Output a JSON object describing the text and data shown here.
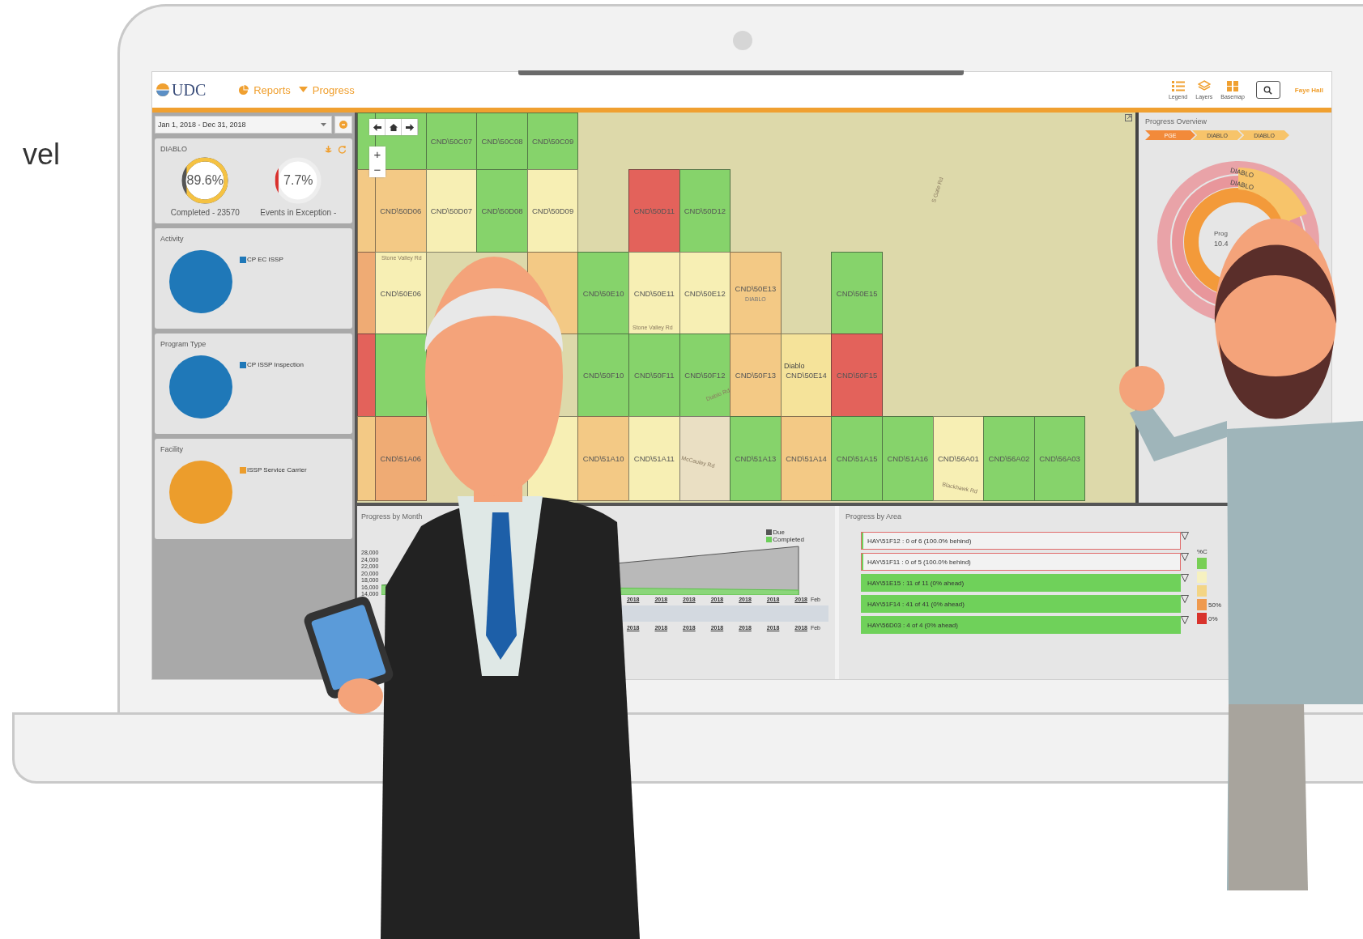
{
  "side_text": "vel",
  "header": {
    "logo": "UDC",
    "breadcrumb": [
      {
        "label": "Reports",
        "kind": "pie"
      },
      {
        "label": "Progress",
        "kind": "caret"
      }
    ],
    "tools": [
      {
        "label": "Legend",
        "kind": "list"
      },
      {
        "label": "Layers",
        "kind": "layers"
      },
      {
        "label": "Basemap",
        "kind": "grid"
      }
    ],
    "user": "Faye Hall"
  },
  "filters": {
    "date_range": "Jan 1, 2018 - Dec 31, 2018"
  },
  "summary": {
    "title": "DIABLO",
    "gauges": [
      {
        "value": "89.6%",
        "level": 0.896,
        "caption": "Completed - 23570",
        "color": "#f5c242"
      },
      {
        "value": "7.7%",
        "level": 0.077,
        "caption": "Events in Exception -",
        "color": "#d9302c"
      }
    ]
  },
  "pie_cards": [
    {
      "title": "Activity",
      "legend": "CP EC ISSP",
      "color": "#1f78b8"
    },
    {
      "title": "Program Type",
      "legend": "CP ISSP Inspection",
      "color": "#1f78b8"
    },
    {
      "title": "Facility",
      "legend": "ISSP Service Carrier",
      "color": "#ec9d2c"
    }
  ],
  "map": {
    "zoom": [
      "+",
      "−"
    ],
    "rows": [
      [
        {
          "kind": "cell",
          "color": "#86d36b"
        },
        {
          "kind": "cell",
          "color": "#86d36b"
        },
        {
          "kind": "cell",
          "color": "#86d36b",
          "label": "CND\\50C07"
        },
        {
          "kind": "cell",
          "color": "#86d36b",
          "label": "CND\\50C08"
        },
        {
          "kind": "cell",
          "color": "#86d36b",
          "label": "CND\\50C09"
        },
        {
          "kind": "blank"
        },
        {
          "kind": "blank"
        },
        {
          "kind": "blank"
        },
        {
          "kind": "blank"
        },
        {
          "kind": "blank"
        },
        {
          "kind": "blank"
        },
        {
          "kind": "blank"
        },
        {
          "kind": "blank"
        },
        {
          "kind": "blank"
        },
        {
          "kind": "blank"
        }
      ],
      [
        {
          "kind": "cell",
          "color": "#f3c985"
        },
        {
          "kind": "cell",
          "color": "#f3c985",
          "label": "CND\\50D06"
        },
        {
          "kind": "cell",
          "color": "#f7efb4",
          "label": "CND\\50D07"
        },
        {
          "kind": "cell",
          "color": "#86d36b",
          "label": "CND\\50D08"
        },
        {
          "kind": "cell",
          "color": "#f7efb4",
          "label": "CND\\50D09"
        },
        {
          "kind": "blank"
        },
        {
          "kind": "cell",
          "color": "#e3625b",
          "label": "CND\\50D11"
        },
        {
          "kind": "cell",
          "color": "#86d36b",
          "label": "CND\\50D12"
        },
        {
          "kind": "blank"
        },
        {
          "kind": "blank"
        },
        {
          "kind": "blank"
        },
        {
          "kind": "blank"
        },
        {
          "kind": "blank"
        },
        {
          "kind": "blank"
        },
        {
          "kind": "blank"
        }
      ],
      [
        {
          "kind": "cell",
          "color": "#efab74"
        },
        {
          "kind": "cell",
          "color": "#f7efb4",
          "label": "CND\\50E06"
        },
        {
          "kind": "blank"
        },
        {
          "kind": "blank"
        },
        {
          "kind": "cell",
          "color": "#f3c985"
        },
        {
          "kind": "cell",
          "color": "#86d36b",
          "label": "CND\\50E10"
        },
        {
          "kind": "cell",
          "color": "#f7efb4",
          "label": "CND\\50E11"
        },
        {
          "kind": "cell",
          "color": "#f7efb4",
          "label": "CND\\50E12"
        },
        {
          "kind": "cell",
          "color": "#f3c985",
          "label": "CND\\50E13",
          "sub": "DIABLO"
        },
        {
          "kind": "blank"
        },
        {
          "kind": "cell",
          "color": "#86d36b",
          "label": "CND\\50E15"
        },
        {
          "kind": "blank"
        },
        {
          "kind": "blank"
        },
        {
          "kind": "blank"
        },
        {
          "kind": "blank"
        }
      ],
      [
        {
          "kind": "cell",
          "color": "#e3625b"
        },
        {
          "kind": "cell",
          "color": "#86d36b"
        },
        {
          "kind": "blank"
        },
        {
          "kind": "blank"
        },
        {
          "kind": "blank"
        },
        {
          "kind": "cell",
          "color": "#86d36b",
          "label": "CND\\50F10"
        },
        {
          "kind": "cell",
          "color": "#86d36b",
          "label": "CND\\50F11"
        },
        {
          "kind": "cell",
          "color": "#86d36b",
          "label": "CND\\50F12"
        },
        {
          "kind": "cell",
          "color": "#f3c985",
          "label": "CND\\50F13"
        },
        {
          "kind": "cell",
          "color": "#f5e39a",
          "label": "CND\\50E14"
        },
        {
          "kind": "cell",
          "color": "#e3625b",
          "label": "CND\\50F15"
        },
        {
          "kind": "blank"
        },
        {
          "kind": "blank"
        },
        {
          "kind": "blank"
        },
        {
          "kind": "blank"
        }
      ],
      [
        {
          "kind": "cell",
          "color": "#f3c985"
        },
        {
          "kind": "cell",
          "color": "#efab74",
          "label": "CND\\51A06"
        },
        {
          "kind": "blank"
        },
        {
          "kind": "blank"
        },
        {
          "kind": "cell",
          "color": "#f7efb4"
        },
        {
          "kind": "cell",
          "color": "#f3c985",
          "label": "CND\\51A10"
        },
        {
          "kind": "cell",
          "color": "#f7efb4",
          "label": "CND\\51A11"
        },
        {
          "kind": "cell",
          "color": "#eadfc3"
        },
        {
          "kind": "cell",
          "color": "#86d36b",
          "label": "CND\\51A13"
        },
        {
          "kind": "cell",
          "color": "#f3c985",
          "label": "CND\\51A14"
        },
        {
          "kind": "cell",
          "color": "#86d36b",
          "label": "CND\\51A15"
        },
        {
          "kind": "cell",
          "color": "#86d36b",
          "label": "CND\\51A16"
        },
        {
          "kind": "cell",
          "color": "#f7efb4",
          "label": "CND\\56A01"
        },
        {
          "kind": "cell",
          "color": "#86d36b",
          "label": "CND\\56A02"
        },
        {
          "kind": "cell",
          "color": "#86d36b",
          "label": "CND\\56A03"
        }
      ]
    ],
    "roads": [
      "Stone Valley Rd",
      "Stone Valley Rd",
      "S Gate Rd",
      "Diablo Rd",
      "McCauley Rd",
      "Blackhawk Rd",
      "Diablo"
    ]
  },
  "overview": {
    "title": "Progress Overview",
    "crumbs": [
      {
        "label": "PGE",
        "selected": true
      },
      {
        "label": "DIABLO",
        "selected": false
      },
      {
        "label": "DIABLO",
        "selected": false
      }
    ],
    "ring_labels": [
      "DIABLO",
      "DIABLO"
    ],
    "center_label": "Prog",
    "center_value": "10.4"
  },
  "month": {
    "title": "Progress by Month",
    "y_ticks": [
      "28,000",
      "24,000",
      "22,000",
      "20,000",
      "18,000",
      "16,000",
      "14,000"
    ],
    "legend": [
      {
        "label": "Due",
        "color": "#555555"
      },
      {
        "label": "Completed",
        "color": "#6ccf5a"
      }
    ],
    "x_labels": [
      "2018",
      "2018",
      "2018",
      "2018",
      "2018",
      "2018",
      "2018"
    ],
    "x_end": "Feb",
    "nav_labels": [
      "2018",
      "2018",
      "2018",
      "2018",
      "2018",
      "2018",
      "2018"
    ],
    "nav_end": "Feb"
  },
  "area": {
    "title": "Progress by Area",
    "rows": [
      {
        "text": "HAY\\51F12 : 0 of 6 (100.0% behind)",
        "kind": "behind",
        "level": 0
      },
      {
        "text": "HAY\\51F11 : 0 of 5 (100.0% behind)",
        "kind": "behind",
        "level": 0
      },
      {
        "text": "HAY\\51E15 : 11 of 11 (0% ahead)",
        "kind": "ahead",
        "level": 1
      },
      {
        "text": "HAY\\51F14 : 41 of 41 (0% ahead)",
        "kind": "ahead",
        "level": 1
      },
      {
        "text": "HAY\\56D03 : 4 of 4 (0% ahead)",
        "kind": "ahead",
        "level": 1
      }
    ],
    "legend": {
      "heading": "%C",
      "items": [
        {
          "color": "#78cf55"
        },
        {
          "color": "#f6f1c0"
        },
        {
          "color": "#f3d585"
        },
        {
          "color": "#ef9a4e",
          "label": "50%"
        },
        {
          "color": "#d8332c",
          "label": "0%"
        }
      ]
    }
  }
}
